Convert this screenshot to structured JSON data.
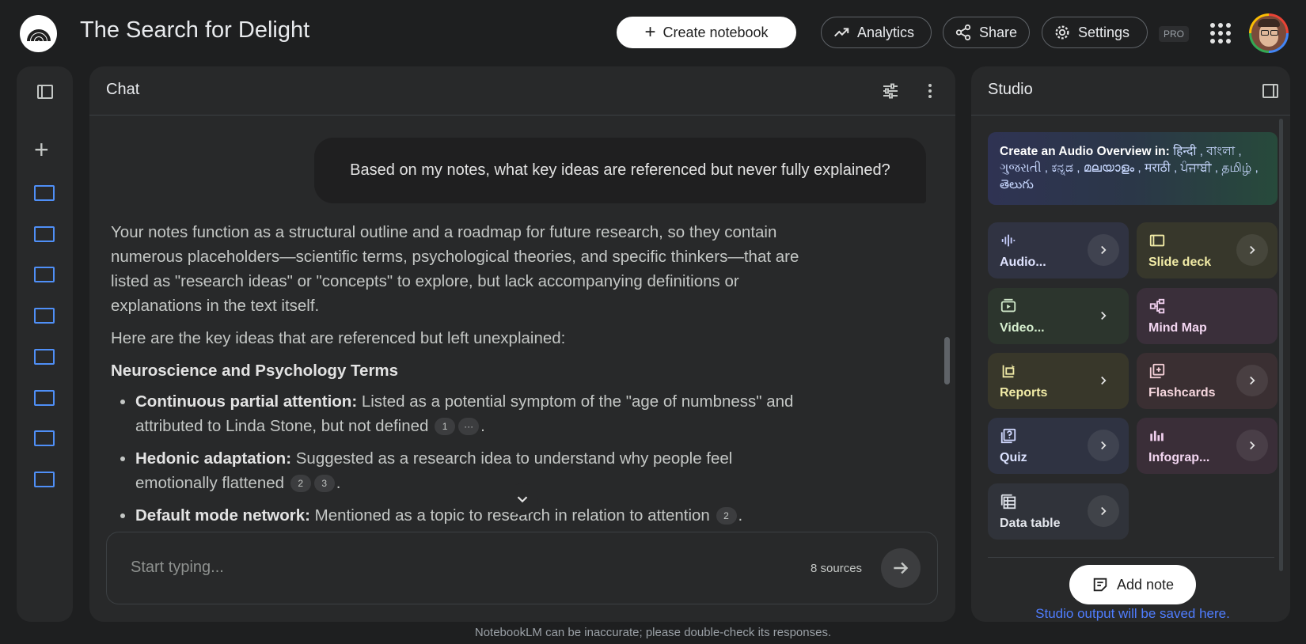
{
  "header": {
    "title": "The Search for Delight",
    "create_label": "Create notebook",
    "analytics_label": "Analytics",
    "share_label": "Share",
    "settings_label": "Settings",
    "pro_label": "PRO"
  },
  "chat": {
    "title": "Chat",
    "user_message": "Based on my notes, what key ideas are referenced but never fully explained?",
    "answer_p1": "Your notes function as a structural outline and a roadmap for future research, so they contain numerous placeholders—scientific terms, psychological theories, and specific thinkers—that are listed as \"research ideas\" or \"concepts\" to explore, but lack accompanying definitions or explanations in the text itself.",
    "answer_p2": "Here are the key ideas that are referenced but left unexplained:",
    "section_heading": "Neuroscience and Psychology Terms",
    "items": [
      {
        "term": "Continuous partial attention:",
        "text": " Listed as a potential symptom of the \"age of numbness\" and attributed to Linda Stone, but not defined ",
        "cites": [
          "1",
          "···"
        ]
      },
      {
        "term": "Hedonic adaptation:",
        "text": " Suggested as a research idea to understand why people feel emotionally flattened ",
        "cites": [
          "2",
          "3"
        ]
      },
      {
        "term": "Default mode network:",
        "text": " Mentioned as a topic to research in relation to attention ",
        "cites": [
          "2"
        ]
      }
    ],
    "input_placeholder": "Start typing...",
    "sources_count": "8 sources"
  },
  "studio": {
    "title": "Studio",
    "audio_prefix": "Create an Audio Overview in: ",
    "audio_langs": "हिन्दी , বাংলা , ગુજરાતી , ಕನ್ನಡ , മലയാളം , मराठी , ਪੰਜਾਬੀ , தமிழ் , తెలుగు",
    "tiles": [
      {
        "label": "Audio...",
        "icon": "audio-waveform-icon"
      },
      {
        "label": "Slide deck",
        "icon": "slides-icon"
      },
      {
        "label": "Video...",
        "icon": "video-icon"
      },
      {
        "label": "Mind Map",
        "icon": "mind-map-icon"
      },
      {
        "label": "Reports",
        "icon": "report-icon"
      },
      {
        "label": "Flashcards",
        "icon": "flashcards-icon"
      },
      {
        "label": "Quiz",
        "icon": "quiz-icon"
      },
      {
        "label": "Infograp...",
        "icon": "infographic-icon"
      },
      {
        "label": "Data table",
        "icon": "table-icon"
      }
    ],
    "add_note_label": "Add note",
    "saved_hint": "Studio output will be saved here."
  },
  "footer": {
    "disclaimer": "NotebookLM can be inaccurate; please double-check its responses."
  },
  "colors": {
    "background": "#1e1f20",
    "panel": "#28292a",
    "accent_blue": "#4f8ff7",
    "tile_audio": "#303342",
    "tile_slides": "#37372b",
    "tile_video": "#2c352d",
    "tile_mindmap": "#3a2f3a",
    "tile_reports": "#38372a",
    "tile_flashcards": "#3a2f32",
    "tile_quiz": "#2f3342",
    "tile_infographic": "#3a2e38",
    "tile_datatable": "#30333a"
  }
}
